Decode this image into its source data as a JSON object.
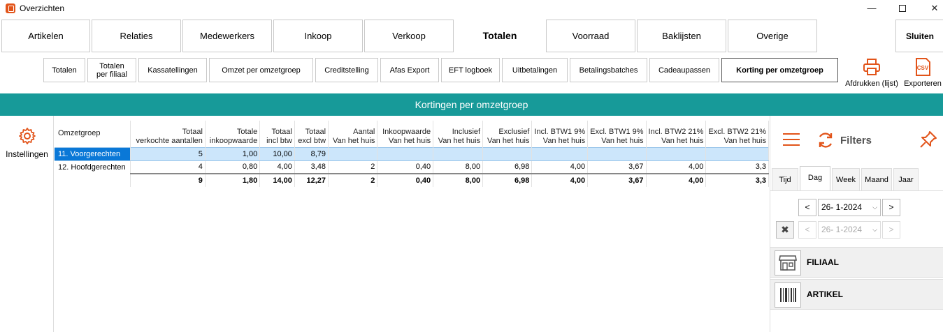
{
  "window": {
    "title": "Overzichten",
    "minimize": "—",
    "close": "✕"
  },
  "main_tabs": [
    {
      "label": "Artikelen"
    },
    {
      "label": "Relaties"
    },
    {
      "label": "Medewerkers"
    },
    {
      "label": "Inkoop"
    },
    {
      "label": "Verkoop"
    },
    {
      "label": "Totalen"
    },
    {
      "label": "Voorraad"
    },
    {
      "label": "Baklijsten"
    },
    {
      "label": "Overige"
    }
  ],
  "close_button": "Sluiten",
  "sub_tabs": [
    {
      "label": "Totalen"
    },
    {
      "label": "Totalen per filiaal"
    },
    {
      "label": "Kassatellingen"
    },
    {
      "label": "Omzet per omzetgroep"
    },
    {
      "label": "Creditstelling"
    },
    {
      "label": "Afas Export"
    },
    {
      "label": "EFT logboek"
    },
    {
      "label": "Uitbetalingen"
    },
    {
      "label": "Betalingsbatches"
    },
    {
      "label": "Cadeaupassen"
    },
    {
      "label": "Korting per omzetgroep"
    }
  ],
  "tools": {
    "print": "Afdrukken (lijst)",
    "export": "Exporteren",
    "csv_badge": "CSV"
  },
  "header_bar": "Kortingen per omzetgroep",
  "settings": {
    "label": "Instellingen"
  },
  "grid": {
    "columns": [
      {
        "line1": "Omzetgroep",
        "line2": ""
      },
      {
        "line1": "Totaal",
        "line2": "verkochte aantallen"
      },
      {
        "line1": "Totale",
        "line2": "inkoopwaarde"
      },
      {
        "line1": "Totaal",
        "line2": "incl btw"
      },
      {
        "line1": "Totaal",
        "line2": "excl btw"
      },
      {
        "line1": "Aantal",
        "line2": "Van het huis"
      },
      {
        "line1": "Inkoopwaarde",
        "line2": "Van het huis"
      },
      {
        "line1": "Inclusief",
        "line2": "Van het huis"
      },
      {
        "line1": "Exclusief",
        "line2": "Van het huis"
      },
      {
        "line1": "Incl. BTW1 9%",
        "line2": "Van het huis"
      },
      {
        "line1": "Excl. BTW1 9%",
        "line2": "Van het huis"
      },
      {
        "line1": "Incl. BTW2 21%",
        "line2": "Van het huis"
      },
      {
        "line1": "Excl. BTW2 21%",
        "line2": "Van het huis"
      }
    ],
    "rows": [
      [
        "11. Voorgerechten",
        "5",
        "1,00",
        "10,00",
        "8,79",
        "",
        "",
        "",
        "",
        "",
        "",
        "",
        ""
      ],
      [
        "12. Hoofdgerechten",
        "4",
        "0,80",
        "4,00",
        "3,48",
        "2",
        "0,40",
        "8,00",
        "6,98",
        "4,00",
        "3,67",
        "4,00",
        "3,3"
      ]
    ],
    "totals": [
      "",
      "9",
      "1,80",
      "14,00",
      "12,27",
      "2",
      "0,40",
      "8,00",
      "6,98",
      "4,00",
      "3,67",
      "4,00",
      "3,3"
    ]
  },
  "filters": {
    "title": "Filters",
    "tabs": [
      {
        "label": "Tijd"
      },
      {
        "label": "Dag"
      },
      {
        "label": "Week"
      },
      {
        "label": "Maand"
      },
      {
        "label": "Jaar"
      }
    ],
    "active_tab": "Dag",
    "date_from": "26- 1-2024",
    "date_to": "26- 1-2024",
    "prev": "<",
    "next": ">",
    "clear": "✖",
    "sections": [
      {
        "label": "FILIAAL"
      },
      {
        "label": "ARTIKEL"
      }
    ]
  },
  "colors": {
    "accent": "#e2541a",
    "teal": "#179a99",
    "selection": "#0a78d7"
  }
}
